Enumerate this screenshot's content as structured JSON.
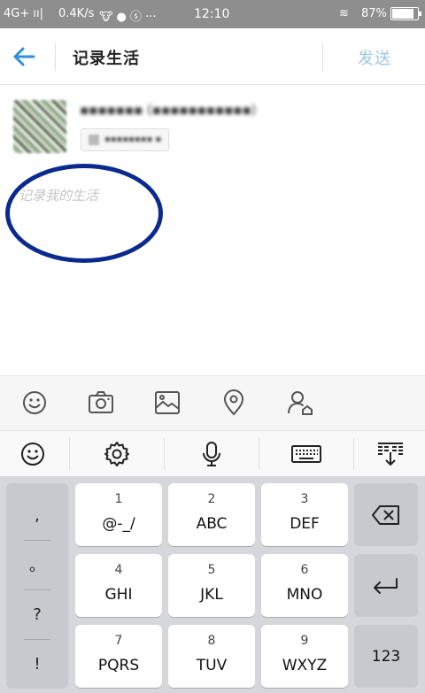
{
  "status_bar": {
    "network": "4G+ ıı|",
    "speed": "0.4K/s",
    "icons": "🐮 ● ⓢ ···",
    "time": "12:10",
    "wifi": "≋",
    "battery_pct": "87%",
    "battery_level": 0.87
  },
  "header": {
    "back_icon": "arrow-left-icon",
    "title": "记录生活",
    "send_label": "发送"
  },
  "compose": {
    "song_title": "▪▪▪▪▪▪▪ (▪▪▪▪▪▪▪▪▪▪▪)",
    "song_tag": "▪▪▪▪▪▪▪▪ ▪",
    "placeholder": "记录我的生活"
  },
  "attach_toolbar": {
    "items": [
      "emoji-icon",
      "camera-icon",
      "image-icon",
      "location-icon",
      "mention-user-icon"
    ]
  },
  "keyboard_toolbar": {
    "items": [
      "emoji-icon",
      "settings-icon",
      "microphone-icon",
      "keyboard-icon",
      "collapse-keyboard-icon"
    ]
  },
  "keyboard": {
    "punct": [
      ",",
      "。",
      "?",
      "!"
    ],
    "keys": [
      {
        "num": "1",
        "letters": "@-_/"
      },
      {
        "num": "2",
        "letters": "ABC"
      },
      {
        "num": "3",
        "letters": "DEF"
      },
      {
        "num": "4",
        "letters": "GHI"
      },
      {
        "num": "5",
        "letters": "JKL"
      },
      {
        "num": "6",
        "letters": "MNO"
      },
      {
        "num": "7",
        "letters": "PQRS"
      },
      {
        "num": "8",
        "letters": "TUV"
      },
      {
        "num": "9",
        "letters": "WXYZ"
      }
    ],
    "backspace_icon": "backspace-icon",
    "enter_icon": "enter-icon",
    "numeric_label": "123"
  },
  "colors": {
    "accent_blue": "#2f8fe0",
    "send_disabled": "#9cc6e8",
    "annotation": "#0b2a8f"
  }
}
